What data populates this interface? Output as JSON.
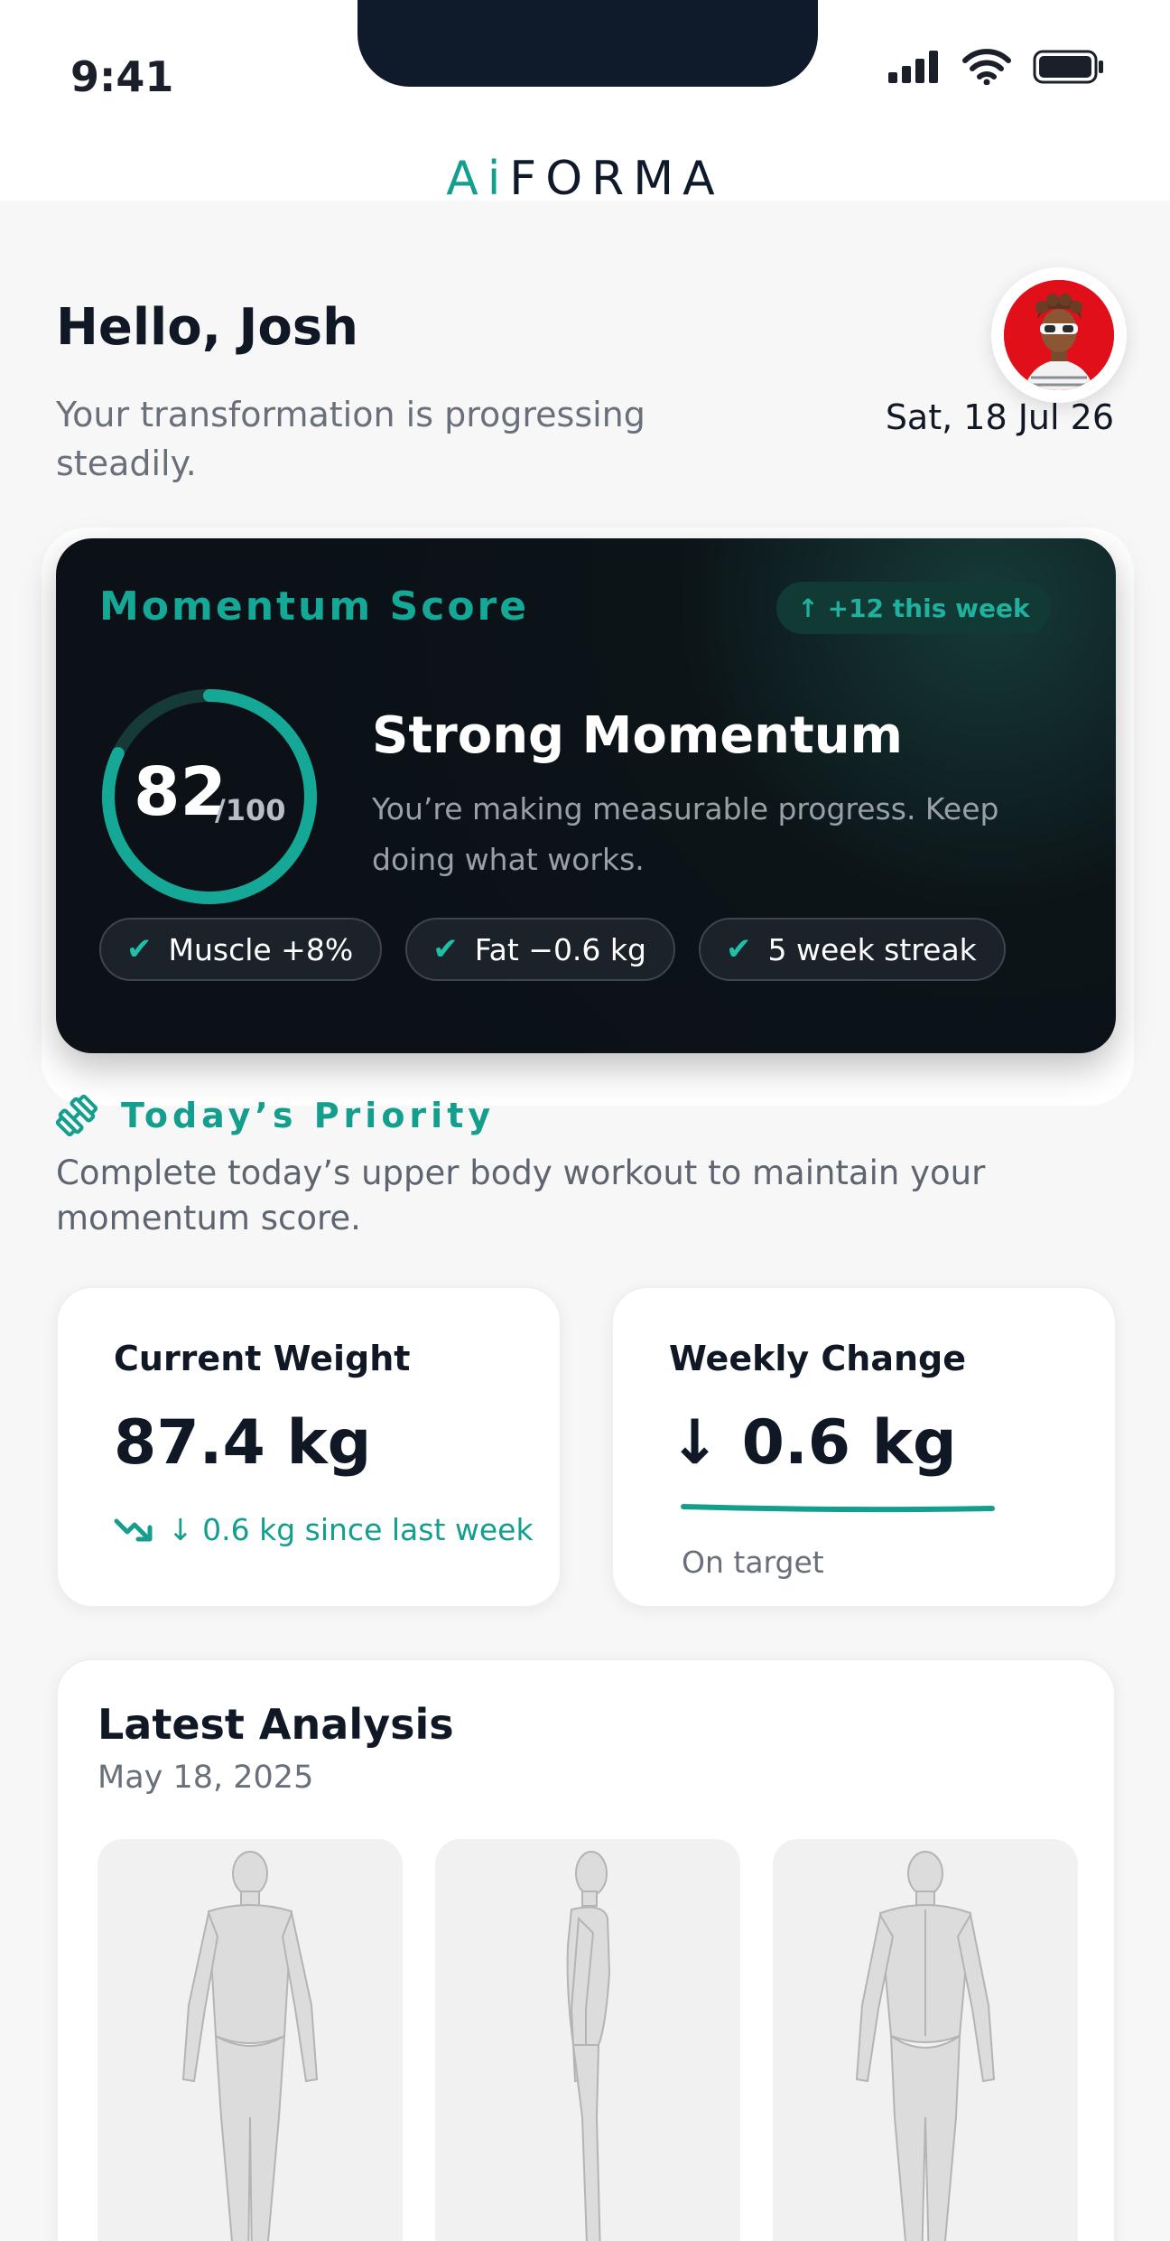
{
  "status_bar": {
    "time": "9:41"
  },
  "brand": {
    "prefix": "Ai",
    "rest": "FORMA"
  },
  "header": {
    "greeting": "Hello, Josh",
    "subtitle": "Your transformation is progressing steadily.",
    "date": "Sat, 18 Jul 26"
  },
  "momentum": {
    "title": "Momentum Score",
    "badge": "↑ +12 this week",
    "score": "82",
    "score_max": "/100",
    "score_fraction": 0.82,
    "headline": "Strong Momentum",
    "description": "You’re making measurable progress. Keep doing what works.",
    "chips": [
      {
        "label": "Muscle +8%"
      },
      {
        "label": "Fat −0.6 kg"
      },
      {
        "label": "5 week streak"
      }
    ]
  },
  "priority": {
    "title": "Today’s Priority",
    "text": "Complete today’s upper body workout to maintain your momentum score."
  },
  "stats": {
    "weight": {
      "label": "Current Weight",
      "value": "87.4 kg",
      "trend": "↓ 0.6 kg since last week"
    },
    "change": {
      "label": "Weekly Change",
      "value": "↓ 0.6 kg",
      "status": "On target"
    }
  },
  "analysis": {
    "title": "Latest Analysis",
    "date": "May 18, 2025",
    "views": [
      "front",
      "side",
      "back"
    ]
  },
  "colors": {
    "accent": "#139e8e",
    "dark_card": "#0b1117",
    "avatar_bg": "#e10f1a"
  },
  "icons": [
    "signal-icon",
    "wifi-icon",
    "battery-icon",
    "check-icon",
    "dumbbell-icon",
    "trend-down-icon"
  ]
}
